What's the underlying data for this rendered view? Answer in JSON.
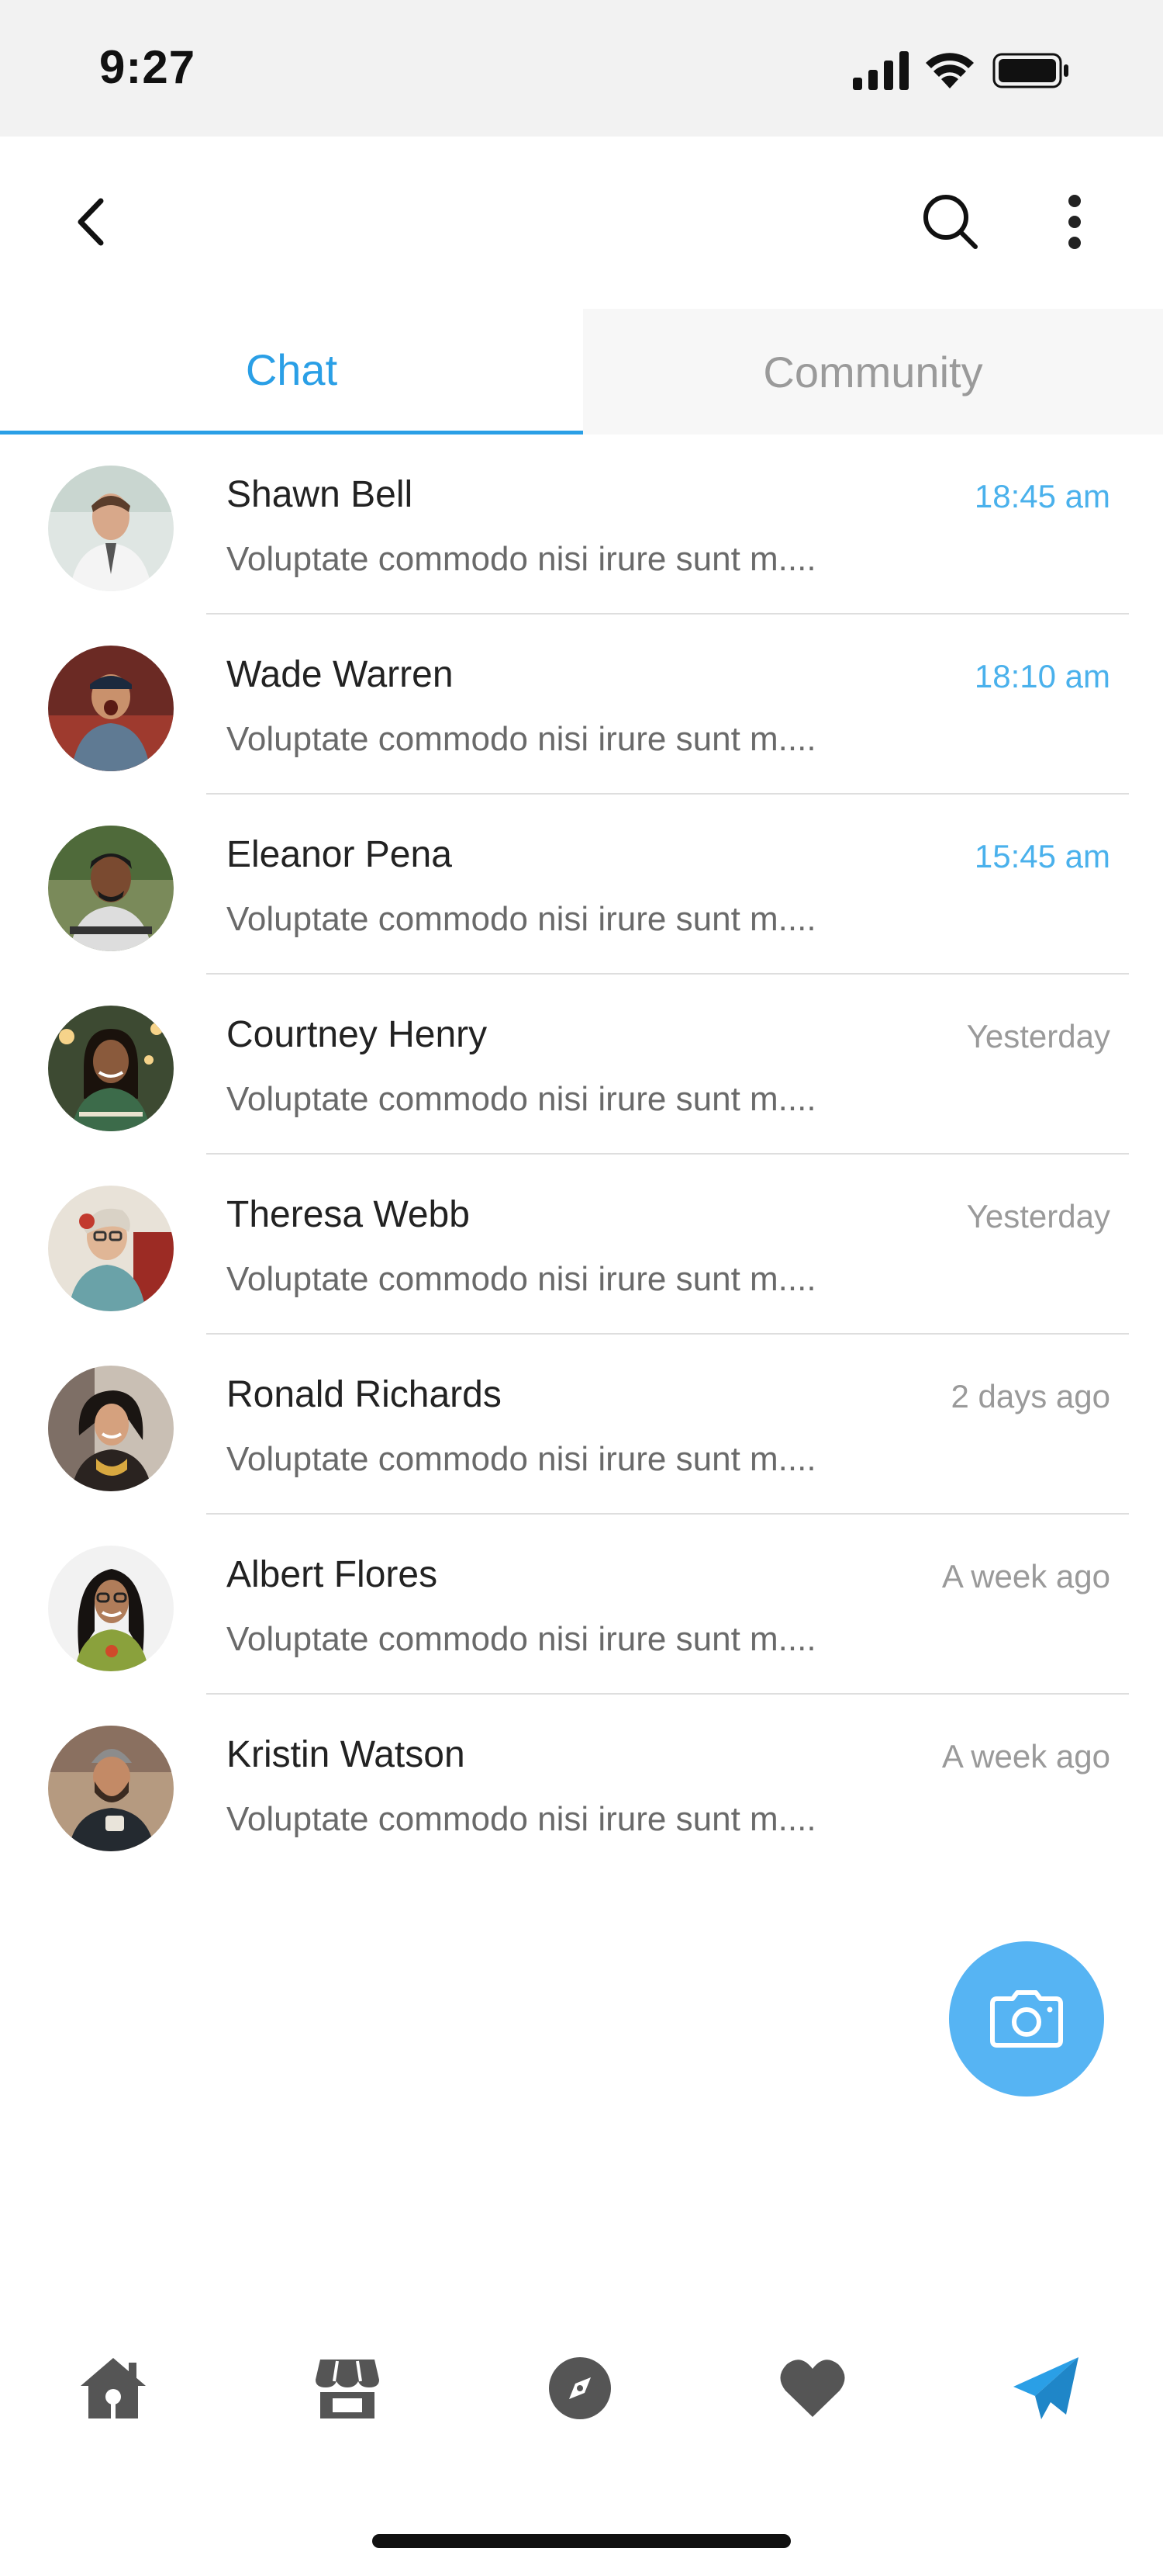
{
  "status_bar": {
    "time": "9:27"
  },
  "header": {
    "back_icon": "chevron-left-icon",
    "search_icon": "search-icon",
    "more_icon": "more-vertical-icon"
  },
  "tabs": [
    {
      "label": "Chat",
      "selected": true
    },
    {
      "label": "Community",
      "selected": false
    }
  ],
  "colors": {
    "accent": "#2a9fe6",
    "fresh_time": "#4ab1ec",
    "fab": "#56b4f3",
    "muted": "#9a9a9a"
  },
  "chats": [
    {
      "name": "Shawn Bell",
      "preview": "Voluptate commodo nisi irure sunt m....",
      "time": "18:45 am",
      "fresh": true
    },
    {
      "name": "Wade Warren",
      "preview": "Voluptate commodo nisi irure sunt m....",
      "time": "18:10 am",
      "fresh": true
    },
    {
      "name": "Eleanor Pena",
      "preview": "Voluptate commodo nisi irure sunt m....",
      "time": "15:45 am",
      "fresh": true
    },
    {
      "name": "Courtney Henry",
      "preview": "Voluptate commodo nisi irure sunt m....",
      "time": "Yesterday",
      "fresh": false
    },
    {
      "name": "Theresa Webb",
      "preview": "Voluptate commodo nisi irure sunt m....",
      "time": "Yesterday",
      "fresh": false
    },
    {
      "name": "Ronald Richards",
      "preview": "Voluptate commodo nisi irure sunt m....",
      "time": "2 days ago",
      "fresh": false
    },
    {
      "name": "Albert Flores",
      "preview": "Voluptate commodo nisi irure sunt m....",
      "time": "A week ago",
      "fresh": false
    },
    {
      "name": "Kristin Watson",
      "preview": "Voluptate commodo nisi irure sunt m....",
      "time": "A week ago",
      "fresh": false
    }
  ],
  "fab": {
    "icon": "camera-icon"
  },
  "bottom_nav": [
    {
      "icon": "home-icon",
      "active": false
    },
    {
      "icon": "store-icon",
      "active": false
    },
    {
      "icon": "compass-icon",
      "active": false
    },
    {
      "icon": "heart-icon",
      "active": false
    },
    {
      "icon": "send-icon",
      "active": true
    }
  ]
}
